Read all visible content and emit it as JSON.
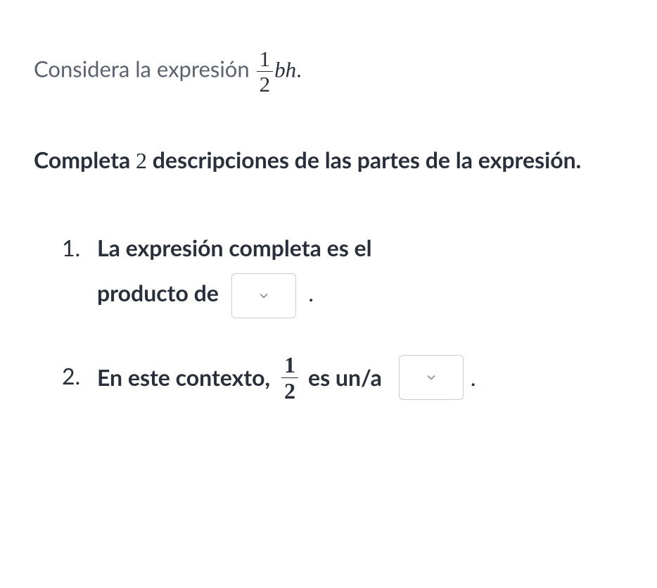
{
  "intro": {
    "prefix": "Considera la expresión ",
    "frac_num": "1",
    "frac_den": "2",
    "var": "bh",
    "suffix": "."
  },
  "instruction": {
    "part1": "Completa ",
    "number": "2",
    "part2": " descripciones de las partes de la expresión."
  },
  "q1": {
    "line1": "La expresión completa es el",
    "line2_before": "producto de ",
    "line2_after": "."
  },
  "q2": {
    "before": "En este contexto, ",
    "frac_num": "1",
    "frac_den": "2",
    "mid": " es un/a ",
    "after": "."
  }
}
